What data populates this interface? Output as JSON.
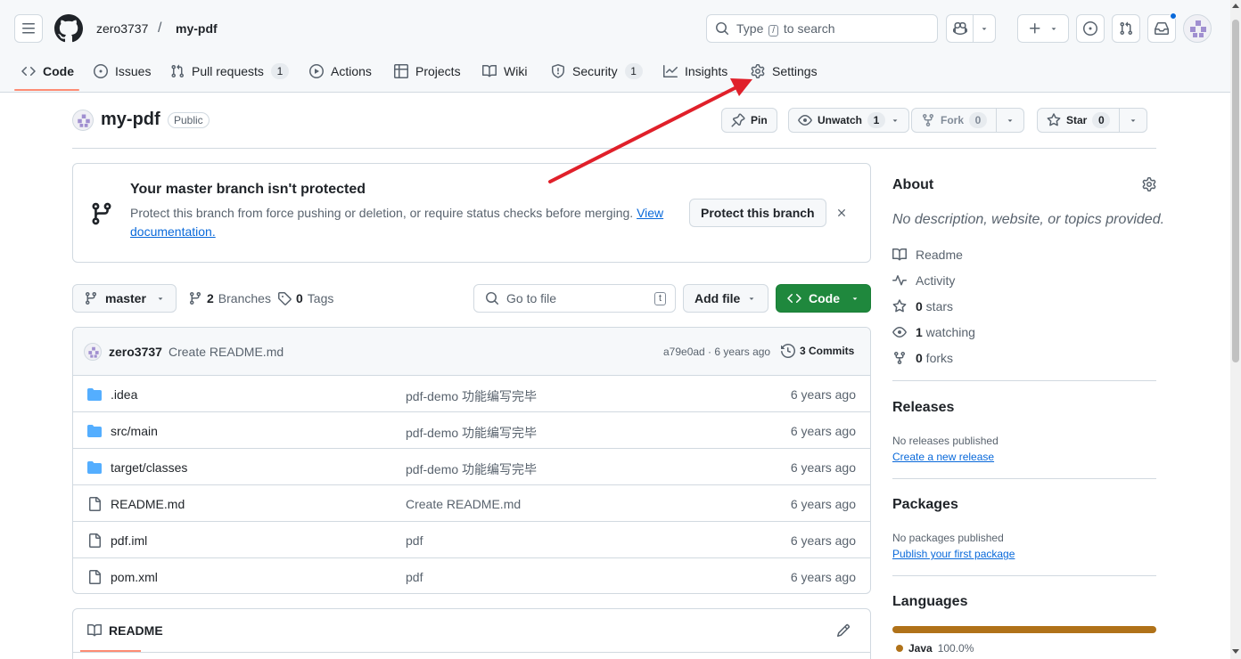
{
  "header": {
    "owner": "zero3737",
    "separator": "/",
    "repo": "my-pdf",
    "search_prefix": "Type",
    "search_key": "/",
    "search_suffix": "to search"
  },
  "tabs": [
    {
      "label": "Code",
      "active": true
    },
    {
      "label": "Issues"
    },
    {
      "label": "Pull requests",
      "count": "1"
    },
    {
      "label": "Actions"
    },
    {
      "label": "Projects"
    },
    {
      "label": "Wiki"
    },
    {
      "label": "Security",
      "count": "1"
    },
    {
      "label": "Insights"
    },
    {
      "label": "Settings"
    }
  ],
  "repo_header": {
    "name": "my-pdf",
    "visibility": "Public",
    "pin_label": "Pin",
    "unwatch_label": "Unwatch",
    "watch_count": "1",
    "fork_label": "Fork",
    "fork_count": "0",
    "star_label": "Star",
    "star_count": "0"
  },
  "banner": {
    "title": "Your master branch isn't protected",
    "text": "Protect this branch from force pushing or deletion, or require status checks before merging.",
    "link_1": "View",
    "link_2": "documentation.",
    "button": "Protect this branch"
  },
  "toolbar": {
    "branch": "master",
    "branches_count": "2",
    "branches_label": "Branches",
    "tags_count": "0",
    "tags_label": "Tags",
    "goto_placeholder": "Go to file",
    "goto_key": "t",
    "add_file": "Add file",
    "code": "Code"
  },
  "commit": {
    "author": "zero3737",
    "message": "Create README.md",
    "meta": "a79e0ad · 6 years ago",
    "commits_label": "3 Commits"
  },
  "files": [
    {
      "name": ".idea",
      "type": "folder",
      "message": "pdf-demo 功能编写完毕",
      "age": "6 years ago"
    },
    {
      "name": "src/main",
      "type": "folder",
      "message": "pdf-demo 功能编写完毕",
      "age": "6 years ago"
    },
    {
      "name": "target/classes",
      "type": "folder",
      "message": "pdf-demo 功能编写完毕",
      "age": "6 years ago"
    },
    {
      "name": "README.md",
      "type": "file",
      "message": "Create README.md",
      "age": "6 years ago"
    },
    {
      "name": "pdf.iml",
      "type": "file",
      "message": "pdf",
      "age": "6 years ago"
    },
    {
      "name": "pom.xml",
      "type": "file",
      "message": "pdf",
      "age": "6 years ago"
    }
  ],
  "readme": {
    "title": "README"
  },
  "sidebar": {
    "about_title": "About",
    "about_desc": "No description, website, or topics provided.",
    "items": [
      {
        "icon": "book-icon",
        "label": "Readme"
      },
      {
        "icon": "pulse-icon",
        "label": "Activity"
      },
      {
        "icon": "star-icon",
        "bold": "0",
        "label": " stars"
      },
      {
        "icon": "eye-icon",
        "bold": "1",
        "label": " watching"
      },
      {
        "icon": "fork-icon",
        "bold": "0",
        "label": " forks"
      }
    ],
    "releases_title": "Releases",
    "releases_text": "No releases published",
    "releases_link": "Create a new release",
    "packages_title": "Packages",
    "packages_text": "No packages published",
    "packages_link": "Publish your first package",
    "languages_title": "Languages",
    "language_name": "Java",
    "language_percent": "100.0%",
    "language_share": 100,
    "language_color": "#b07219"
  },
  "colors": {
    "accent_green": "#1f883d",
    "link": "#0969da",
    "active_tab": "#fd8c73",
    "annotation_arrow": "#e0202a"
  }
}
